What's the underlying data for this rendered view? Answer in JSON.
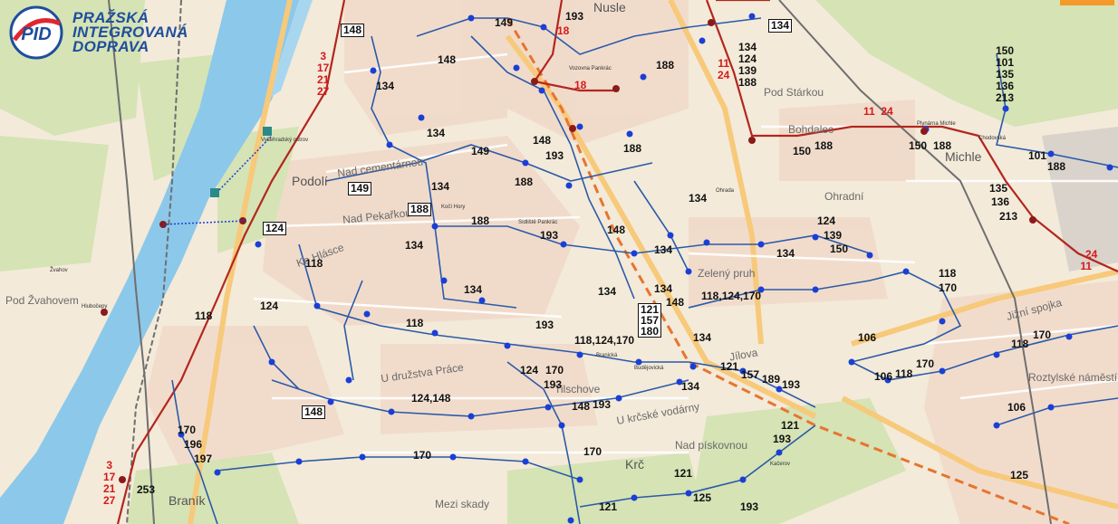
{
  "logo": {
    "mark": "PID",
    "line1": "PRAŽSKÁ",
    "line2": "INTEGROVANÁ",
    "line3": "DOPRAVA"
  },
  "colors": {
    "river": "#8cc8ea",
    "bus_stop": "#1a3fd6",
    "bus_route": "#2b5aa8",
    "tram_route": "#b3261e",
    "tram_stop": "#8b1a1a",
    "metro_planned": "#e8742e",
    "park": "#d5e3b5",
    "residential": "#f0d9c9",
    "road_major": "#f7c97a"
  },
  "districts": [
    {
      "key": "podoli",
      "name": "Podolí"
    },
    {
      "key": "michle",
      "name": "Michle"
    },
    {
      "key": "krc",
      "name": "Krč"
    },
    {
      "key": "branik",
      "name": "Braník"
    },
    {
      "key": "nusle",
      "name": "Nusle"
    }
  ],
  "streets": [
    {
      "key": "nad_cementarnou",
      "name": "Nad cementárnou"
    },
    {
      "key": "nad_pekarkou",
      "name": "Nad Pekařkou"
    },
    {
      "key": "ke_hlasce",
      "name": "Ke Hlásce"
    },
    {
      "key": "u_druzstva_prace",
      "name": "U družstva Práce"
    },
    {
      "key": "tilschove",
      "name": "Tilschove"
    },
    {
      "key": "bohdalec",
      "name": "Bohdalec"
    },
    {
      "key": "ohradni",
      "name": "Ohradní"
    },
    {
      "key": "zeleny_pruh",
      "name": "Zelený pruh"
    },
    {
      "key": "jilova",
      "name": "Jílova"
    },
    {
      "key": "pod_starkou",
      "name": "Pod Stárkou"
    },
    {
      "key": "u_krcske_vodarny",
      "name": "U krčské vodárny"
    },
    {
      "key": "nad_piskovnou",
      "name": "Nad pískovnou"
    },
    {
      "key": "mezi_skady",
      "name": "Mezi skady"
    },
    {
      "key": "roztylske_namesti",
      "name": "Roztylské náměstí"
    },
    {
      "key": "jizni_spojka",
      "name": "Jižní spojka"
    },
    {
      "key": "pod_zvahovem",
      "name": "Pod Žvahovem"
    }
  ],
  "stops": [
    {
      "key": "vysehradsky_ostrov",
      "name": "Vyšehradský ostrov"
    },
    {
      "key": "vozovna_pankrac",
      "name": "Vozovna Pankrác"
    },
    {
      "key": "kacerov",
      "name": "Kačerov"
    },
    {
      "key": "ohrada",
      "name": "Ohrada"
    },
    {
      "key": "koh_hory",
      "name": "Kočí Hory"
    },
    {
      "key": "sidliste_pankrac",
      "name": "Sídliště Pankrác"
    },
    {
      "key": "branicka",
      "name": "Branická"
    },
    {
      "key": "budejovicka",
      "name": "Budějovická"
    },
    {
      "key": "michle_lbl",
      "name": "Plynárna Michle"
    },
    {
      "key": "chodovska",
      "name": "Chodovská"
    },
    {
      "key": "zvahov",
      "name": "Žvahov"
    },
    {
      "key": "hluboccy",
      "name": "Hlubočepy"
    }
  ],
  "routes": {
    "bus_labels": [
      {
        "key": "r148a",
        "text": "148",
        "boxed": true
      },
      {
        "key": "r149a",
        "text": "149",
        "boxed": false
      },
      {
        "key": "r193a",
        "text": "193",
        "boxed": false
      },
      {
        "key": "r148b",
        "text": "148",
        "boxed": false
      },
      {
        "key": "r134a",
        "text": "134",
        "boxed": false
      },
      {
        "key": "r134b",
        "text": "134",
        "boxed": false
      },
      {
        "key": "r149b",
        "text": "149",
        "boxed": false
      },
      {
        "key": "r148c",
        "text": "148",
        "boxed": false
      },
      {
        "key": "r193b",
        "text": "193",
        "boxed": false
      },
      {
        "key": "r188a",
        "text": "188",
        "boxed": false
      },
      {
        "key": "r188b",
        "text": "188",
        "boxed": false
      },
      {
        "key": "r149c",
        "text": "149",
        "boxed": true
      },
      {
        "key": "r134c",
        "text": "134",
        "boxed": false
      },
      {
        "key": "r188c",
        "text": "188",
        "boxed": true
      },
      {
        "key": "r188d",
        "text": "188",
        "boxed": false
      },
      {
        "key": "r193c",
        "text": "193",
        "boxed": false
      },
      {
        "key": "r124a",
        "text": "124",
        "boxed": true
      },
      {
        "key": "r134d",
        "text": "134",
        "boxed": false
      },
      {
        "key": "r118a",
        "text": "118",
        "boxed": false
      },
      {
        "key": "r148d",
        "text": "148",
        "boxed": false
      },
      {
        "key": "r134e",
        "text": "134",
        "boxed": false
      },
      {
        "key": "r134f",
        "text": "134",
        "boxed": false
      },
      {
        "key": "r134g",
        "text": "134",
        "boxed": false
      },
      {
        "key": "r148e",
        "text": "148",
        "boxed": false
      },
      {
        "key": "r118b",
        "text": "118",
        "boxed": false
      },
      {
        "key": "r124b",
        "text": "124",
        "boxed": false
      },
      {
        "key": "r118c",
        "text": "118",
        "boxed": false
      },
      {
        "key": "r193d",
        "text": "193",
        "boxed": false
      },
      {
        "key": "r118x",
        "text": "118,124,170",
        "boxed": false
      },
      {
        "key": "r134h",
        "text": "134",
        "boxed": false
      },
      {
        "key": "r134i",
        "text": "134",
        "boxed": false
      },
      {
        "key": "r121a",
        "text": "121",
        "boxed": false
      },
      {
        "key": "r157a",
        "text": "157",
        "boxed": false
      },
      {
        "key": "r189a",
        "text": "189",
        "boxed": false
      },
      {
        "key": "r193e",
        "text": "193",
        "boxed": false
      },
      {
        "key": "r134j",
        "text": "134",
        "boxed": false
      },
      {
        "key": "r124c",
        "text": "124",
        "boxed": false
      },
      {
        "key": "r170a",
        "text": "170",
        "boxed": false
      },
      {
        "key": "r193f",
        "text": "193",
        "boxed": false
      },
      {
        "key": "r148f",
        "text": "148",
        "boxed": false
      },
      {
        "key": "r193g",
        "text": "193",
        "boxed": false
      },
      {
        "key": "r124148",
        "text": "124,148",
        "boxed": false
      },
      {
        "key": "r148g",
        "text": "148",
        "boxed": true
      },
      {
        "key": "r170b",
        "text": "170",
        "boxed": false
      },
      {
        "key": "r196",
        "text": "196",
        "boxed": false
      },
      {
        "key": "r197",
        "text": "197",
        "boxed": false
      },
      {
        "key": "r253",
        "text": "253",
        "boxed": false
      },
      {
        "key": "r170c",
        "text": "170",
        "boxed": false
      },
      {
        "key": "r170d",
        "text": "170",
        "boxed": false
      },
      {
        "key": "r121b",
        "text": "121",
        "boxed": false
      },
      {
        "key": "r193h",
        "text": "193",
        "boxed": false
      },
      {
        "key": "r121c",
        "text": "121",
        "boxed": false
      },
      {
        "key": "r125a",
        "text": "125",
        "boxed": false
      },
      {
        "key": "r193i",
        "text": "193",
        "boxed": false
      },
      {
        "key": "r121d",
        "text": "121",
        "boxed": false
      },
      {
        "key": "r134k",
        "text": "134",
        "boxed": true
      },
      {
        "key": "r188e",
        "text": "188",
        "boxed": false
      },
      {
        "key": "r188f",
        "text": "188",
        "boxed": false
      },
      {
        "key": "r150a",
        "text": "150",
        "boxed": false
      },
      {
        "key": "r188g",
        "text": "188",
        "boxed": false
      },
      {
        "key": "r134l",
        "text": "134",
        "boxed": false
      },
      {
        "key": "r124d",
        "text": "124",
        "boxed": false
      },
      {
        "key": "r139a",
        "text": "139",
        "boxed": false
      },
      {
        "key": "r150b",
        "text": "150",
        "boxed": false
      },
      {
        "key": "r134m",
        "text": "134",
        "boxed": false
      },
      {
        "key": "r118x2",
        "text": "118,124,170",
        "boxed": false
      },
      {
        "key": "r150c",
        "text": "150",
        "boxed": false
      },
      {
        "key": "r188h",
        "text": "188",
        "boxed": false
      },
      {
        "key": "r101a",
        "text": "101",
        "boxed": false
      },
      {
        "key": "r188i",
        "text": "188",
        "boxed": false
      },
      {
        "key": "r135",
        "text": "135",
        "boxed": false
      },
      {
        "key": "r136",
        "text": "136",
        "boxed": false
      },
      {
        "key": "r213",
        "text": "213",
        "boxed": false
      },
      {
        "key": "r118d",
        "text": "118",
        "boxed": false
      },
      {
        "key": "r170e",
        "text": "170",
        "boxed": false
      },
      {
        "key": "r106a",
        "text": "106",
        "boxed": false
      },
      {
        "key": "r106b",
        "text": "106",
        "boxed": false
      },
      {
        "key": "r118e",
        "text": "118",
        "boxed": false
      },
      {
        "key": "r170f",
        "text": "170",
        "boxed": false
      },
      {
        "key": "r118f",
        "text": "118",
        "boxed": false
      },
      {
        "key": "r170g",
        "text": "170",
        "boxed": false
      },
      {
        "key": "r106c",
        "text": "106",
        "boxed": false
      },
      {
        "key": "r125b",
        "text": "125",
        "boxed": false
      }
    ],
    "stack_center": [
      "134",
      "124",
      "139",
      "188"
    ],
    "stack_center_boxed": [
      "121",
      "157",
      "180"
    ],
    "stack_right": [
      "150",
      "101",
      "135",
      "136",
      "213"
    ],
    "tram_labels": {
      "left": [
        "3",
        "17",
        "21",
        "27"
      ],
      "bottom_left": [
        "3",
        "17",
        "21",
        "27"
      ],
      "nusle": "18",
      "vozovna": "18",
      "center_top": [
        "11",
        "24"
      ],
      "michle_mid": [
        "11",
        "24"
      ],
      "right_edge": [
        "24",
        "11"
      ]
    }
  }
}
